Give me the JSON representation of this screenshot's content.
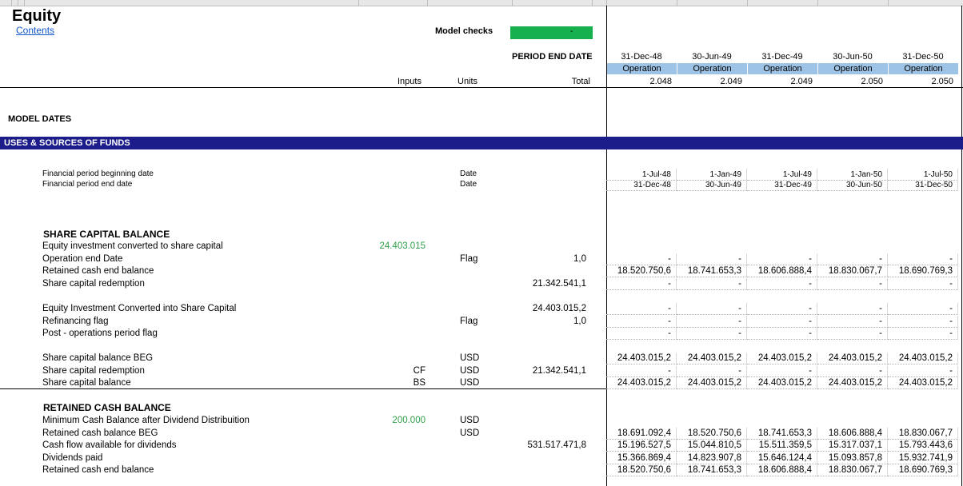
{
  "sheet_title": "Equity",
  "contents_link": "Contents",
  "model_checks_label": "Model checks",
  "model_checks_value": "-",
  "model_checks_color": "#16b14e",
  "period_end_label": "PERIOD END DATE",
  "column_headers": {
    "inputs": "Inputs",
    "units": "Units",
    "total": "Total"
  },
  "periods": [
    {
      "date": "31-Dec-48",
      "phase": "Operation",
      "year": "2.048"
    },
    {
      "date": "30-Jun-49",
      "phase": "Operation",
      "year": "2.049"
    },
    {
      "date": "31-Dec-49",
      "phase": "Operation",
      "year": "2.049"
    },
    {
      "date": "30-Jun-50",
      "phase": "Operation",
      "year": "2.050"
    },
    {
      "date": "31-Dec-50",
      "phase": "Operation",
      "year": "2.050"
    }
  ],
  "sections": {
    "model_dates": "MODEL DATES",
    "uses_sources": "USES & SOURCES OF FUNDS",
    "share_capital": "SHARE CAPITAL BALANCE",
    "retained_cash": "RETAINED CASH BALANCE"
  },
  "band_color": "#1c1c8a",
  "phase_color": "#9dc3e6",
  "rows": [
    {
      "label": "Financial period beginning date",
      "units": "Date",
      "values": [
        "1-Jul-48",
        "1-Jan-49",
        "1-Jul-49",
        "1-Jan-50",
        "1-Jul-50"
      ]
    },
    {
      "label": "Financial period end date",
      "units": "Date",
      "values": [
        "31-Dec-48",
        "30-Jun-49",
        "31-Dec-49",
        "30-Jun-50",
        "31-Dec-50"
      ]
    },
    {
      "label": "Equity investment converted to share capital",
      "input": "24.403.015"
    },
    {
      "label": "Operation end Date",
      "units": "Flag",
      "total": "1,0",
      "values": [
        "-",
        "-",
        "-",
        "-",
        "-"
      ]
    },
    {
      "label": "Retained cash end balance",
      "values": [
        "18.520.750,6",
        "18.741.653,3",
        "18.606.888,4",
        "18.830.067,7",
        "18.690.769,3"
      ]
    },
    {
      "label": "Share capital redemption",
      "total": "21.342.541,1",
      "values": [
        "-",
        "-",
        "-",
        "-",
        "-"
      ]
    },
    {
      "label": "Equity Investment Converted into Share Capital",
      "total": "24.403.015,2",
      "values": [
        "-",
        "-",
        "-",
        "-",
        "-"
      ]
    },
    {
      "label": "Refinancing flag",
      "units": "Flag",
      "total": "1,0",
      "values": [
        "-",
        "-",
        "-",
        "-",
        "-"
      ]
    },
    {
      "label": "Post - operations period flag",
      "values": [
        "-",
        "-",
        "-",
        "-",
        "-"
      ]
    },
    {
      "label": "Share capital balance BEG",
      "units": "USD",
      "values": [
        "24.403.015,2",
        "24.403.015,2",
        "24.403.015,2",
        "24.403.015,2",
        "24.403.015,2"
      ]
    },
    {
      "label": "Share capital redemption",
      "input": "CF",
      "units": "USD",
      "total": "21.342.541,1",
      "values": [
        "-",
        "-",
        "-",
        "-",
        "-"
      ]
    },
    {
      "label": "Share capital balance",
      "input": "BS",
      "units": "USD",
      "values": [
        "24.403.015,2",
        "24.403.015,2",
        "24.403.015,2",
        "24.403.015,2",
        "24.403.015,2"
      ]
    },
    {
      "label": "Minimum Cash Balance after Dividend Distribuition",
      "input": "200.000",
      "units": "USD"
    },
    {
      "label": "Retained cash balance BEG",
      "units": "USD",
      "values": [
        "18.691.092,4",
        "18.520.750,6",
        "18.741.653,3",
        "18.606.888,4",
        "18.830.067,7"
      ]
    },
    {
      "label": "Cash flow available for dividends",
      "total": "531.517.471,8",
      "values": [
        "15.196.527,5",
        "15.044.810,5",
        "15.511.359,5",
        "15.317.037,1",
        "15.793.443,6"
      ]
    },
    {
      "label": "Dividends paid",
      "values": [
        "15.366.869,4",
        "14.823.907,8",
        "15.646.124,4",
        "15.093.857,8",
        "15.932.741,9"
      ]
    },
    {
      "label": "Retained cash end balance",
      "values": [
        "18.520.750,6",
        "18.741.653,3",
        "18.606.888,4",
        "18.830.067,7",
        "18.690.769,3"
      ]
    }
  ]
}
